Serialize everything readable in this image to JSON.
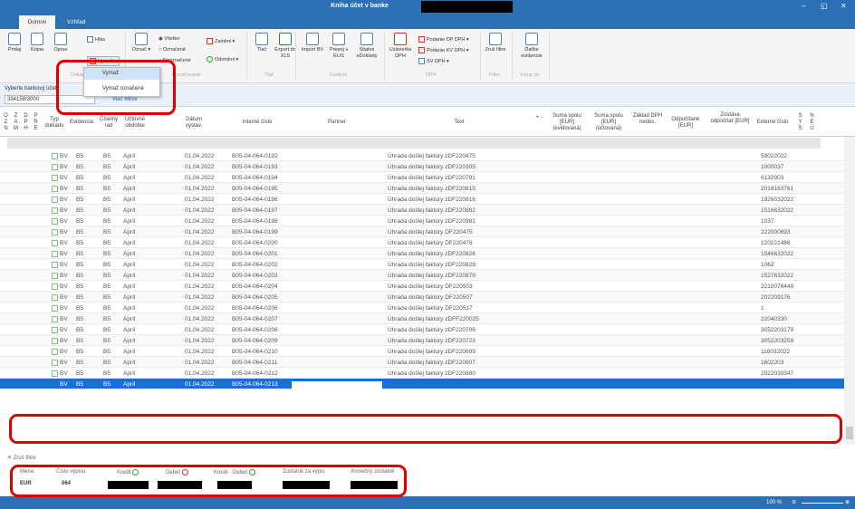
{
  "window": {
    "title": "Kniha účet v banke"
  },
  "tabs": [
    {
      "label": "Domov"
    },
    {
      "label": "Vzhľad"
    }
  ],
  "ribbon": {
    "pridaj": "Pridaj",
    "kopia": "Kópia",
    "opravit": "Oprav",
    "hlas": "Hlás",
    "vymaz": "Vymaž",
    "oznac": "Označ",
    "vsetko": "Všetko",
    "oznacene": "Označené",
    "neoznacene": "Neoznačené",
    "zamkni": "Zamkni",
    "odomkni": "Odomkni",
    "tlac": "Tlač",
    "export": "Export do XLS",
    "import": "Import BV",
    "prepoj": "Prepoj s ELIS",
    "stiahni": "Stiahni eDoklady",
    "uzavierka": "Uzávierka DPH",
    "podanie_dp": "Podanie DP DPH",
    "podanie_kv": "Podanie KV DPH",
    "sv_dph": "SV DPH",
    "zrus_filtre": "Zruš filtre",
    "dalsie_evidencie": "Ďalšie evidencie",
    "group_doklad": "Doklad",
    "group_oznacovanie": "Označovanie",
    "group_tlac": "Tlač",
    "group_funkcie": "Funkcie",
    "group_dph": "DPH",
    "group_filter": "Filter",
    "group_vstup": "Vstup do"
  },
  "dropdown": {
    "items": [
      "Vymaž",
      "Vymaž označené"
    ]
  },
  "filter": {
    "label": "Vyberte bankový účet",
    "value": "334158/3000",
    "more": "Viac filtrov"
  },
  "columns": {
    "ozn": [
      "O",
      "Z",
      "N"
    ],
    "zam": [
      "Z",
      "A",
      "M"
    ],
    "dph": [
      "D",
      "P",
      "H"
    ],
    "pre": [
      "P",
      "R",
      "E"
    ],
    "typ": "Typ dokladu",
    "evidencia": "Evidencia",
    "ciselny": "Číselný rad",
    "uctovne": "Účtovné obdobie",
    "datum": "Dátum vystav.",
    "interne": "Interné číslo",
    "partner": "Partner",
    "text": "Text",
    "plusminus": "+ -",
    "suma_ev": "Suma spolu [EUR] (evidovaná)",
    "suma_uc": "Suma spolu [EUR] (účtovaná)",
    "zaklad": "Základ DPH neobs.",
    "odpocitane": "Odpočítané [EUR]",
    "zostava": "Zostáva odpočítať [EUR]",
    "externe": "Externé číslo",
    "sys": [
      "S",
      "Y",
      "S"
    ],
    "neu": [
      "N",
      "E",
      "Ú"
    ]
  },
  "rows": [
    {
      "typ": "BV",
      "evidencia": "B5",
      "rad": "B5",
      "obdobie": "Apríl",
      "datum": "01.04.2022",
      "interne": "B05-04-064-0192",
      "text": "Úhrada došlej faktúry zDF220475",
      "externe": "59022022"
    },
    {
      "typ": "BV",
      "evidencia": "B5",
      "rad": "B5",
      "obdobie": "Apríl",
      "datum": "01.04.2022",
      "interne": "B05-04-064-0193",
      "text": "Úhrada došlej faktúry zDF220305",
      "externe": "1000037"
    },
    {
      "typ": "BV",
      "evidencia": "B5",
      "rad": "B5",
      "obdobie": "Apríl",
      "datum": "01.04.2022",
      "interne": "B05-04-064-0194",
      "text": "Úhrada došlej faktúry zDF220791",
      "externe": "6132903"
    },
    {
      "typ": "BV",
      "evidencia": "B5",
      "rad": "B5",
      "obdobie": "Apríl",
      "datum": "01.04.2022",
      "interne": "B05-04-064-0195",
      "text": "Úhrada došlej faktúry zDF220815",
      "externe": "2018163761"
    },
    {
      "typ": "BV",
      "evidencia": "B5",
      "rad": "B5",
      "obdobie": "Apríl",
      "datum": "01.04.2022",
      "interne": "B05-04-064-0196",
      "text": "Úhrada došlej faktúry zDF220816",
      "externe": "1926032022"
    },
    {
      "typ": "BV",
      "evidencia": "B5",
      "rad": "B5",
      "obdobie": "Apríl",
      "datum": "01.04.2022",
      "interne": "B05-04-064-0197",
      "text": "Úhrada došlej faktúry zDF220882",
      "externe": "1516632022"
    },
    {
      "typ": "BV",
      "evidencia": "B5",
      "rad": "B5",
      "obdobie": "Apríl",
      "datum": "01.04.2022",
      "interne": "B05-04-064-0198",
      "text": "Úhrada došlej faktúry zDF220981",
      "externe": "1037"
    },
    {
      "typ": "BV",
      "evidencia": "B5",
      "rad": "B5",
      "obdobie": "Apríl",
      "datum": "01.04.2022",
      "interne": "B05-04-064-0199",
      "text": "Úhrada došlej faktúry DF220475",
      "externe": "222000693"
    },
    {
      "typ": "BV",
      "evidencia": "B5",
      "rad": "B5",
      "obdobie": "Apríl",
      "datum": "01.04.2022",
      "interne": "B05-04-064-0200",
      "text": "Úhrada došlej faktúry DF220478",
      "externe": "120221486"
    },
    {
      "typ": "BV",
      "evidencia": "B5",
      "rad": "B5",
      "obdobie": "Apríl",
      "datum": "01.04.2022",
      "interne": "B05-04-064-0201",
      "text": "Úhrada došlej faktúry zDF220826",
      "externe": "1546632022"
    },
    {
      "typ": "BV",
      "evidencia": "B5",
      "rad": "B5",
      "obdobie": "Apríl",
      "datum": "01.04.2022",
      "interne": "B05-04-064-0202",
      "text": "Úhrada došlej faktúry zDF220828",
      "externe": "1062"
    },
    {
      "typ": "BV",
      "evidencia": "B5",
      "rad": "B5",
      "obdobie": "Apríl",
      "datum": "01.04.2022",
      "interne": "B05-04-064-0203",
      "text": "Úhrada došlej faktúry zDF220879",
      "externe": "1527632022"
    },
    {
      "typ": "BV",
      "evidencia": "B5",
      "rad": "B5",
      "obdobie": "Apríl",
      "datum": "01.04.2022",
      "interne": "B05-04-064-0204",
      "text": "Úhrada došlej faktúry DF220503",
      "externe": "2210076449"
    },
    {
      "typ": "BV",
      "evidencia": "B5",
      "rad": "B5",
      "obdobie": "Apríl",
      "datum": "01.04.2022",
      "interne": "B05-04-064-0205",
      "text": "Úhrada došlej faktúry DF220507",
      "externe": "202209176"
    },
    {
      "typ": "BV",
      "evidencia": "B5",
      "rad": "B5",
      "obdobie": "Apríl",
      "datum": "01.04.2022",
      "interne": "B05-04-064-0206",
      "text": "Úhrada došlej faktúry DF220517",
      "externe": "1"
    },
    {
      "typ": "BV",
      "evidencia": "B5",
      "rad": "B5",
      "obdobie": "Apríl",
      "datum": "01.04.2022",
      "interne": "B05-04-064-0207",
      "text": "Úhrada došlej faktúry zDFF220025",
      "externe": "22040330"
    },
    {
      "typ": "BV",
      "evidencia": "B5",
      "rad": "B5",
      "obdobie": "Apríl",
      "datum": "01.04.2022",
      "interne": "B05-04-064-0208",
      "text": "Úhrada došlej faktúry zDF220706",
      "externe": "3052203179"
    },
    {
      "typ": "BV",
      "evidencia": "B5",
      "rad": "B5",
      "obdobie": "Apríl",
      "datum": "01.04.2022",
      "interne": "B05-04-064-0209",
      "text": "Úhrada došlej faktúry zDF220723",
      "externe": "3052203259"
    },
    {
      "typ": "BV",
      "evidencia": "B5",
      "rad": "B5",
      "obdobie": "Apríl",
      "datum": "01.04.2022",
      "interne": "B05-04-064-0210",
      "text": "Úhrada došlej faktúry zDF220699",
      "externe": "116032022"
    },
    {
      "typ": "BV",
      "evidencia": "B5",
      "rad": "B5",
      "obdobie": "Apríl",
      "datum": "01.04.2022",
      "interne": "B05-04-064-0211",
      "text": "Úhrada došlej faktúry zDF220807",
      "externe": "1602203"
    },
    {
      "typ": "BV",
      "evidencia": "B5",
      "rad": "B5",
      "obdobie": "Apríl",
      "datum": "01.04.2022",
      "interne": "B05-04-064-0212",
      "text": "Úhrada došlej faktúry zDF220880",
      "externe": "2022030347"
    }
  ],
  "selected_row": {
    "typ": "BV",
    "evidencia": "B5",
    "rad": "B5",
    "obdobie": "Apríl",
    "datum": "01.04.2022",
    "interne": "B05-04-064-0213"
  },
  "footer": {
    "zrus_filtre": "Zruš filtre",
    "mena_label": "Mena",
    "mena": "EUR",
    "cislo_label": "Číslo výpisu",
    "cislo": "064",
    "kredit": "Kredit",
    "debet": "Debet",
    "kredit_debet": "Kredit - Debet",
    "zostatok_vypis": "Zostatok za výpis",
    "konecny": "Konečný zostatok"
  },
  "status": {
    "zoom": "100 %"
  }
}
